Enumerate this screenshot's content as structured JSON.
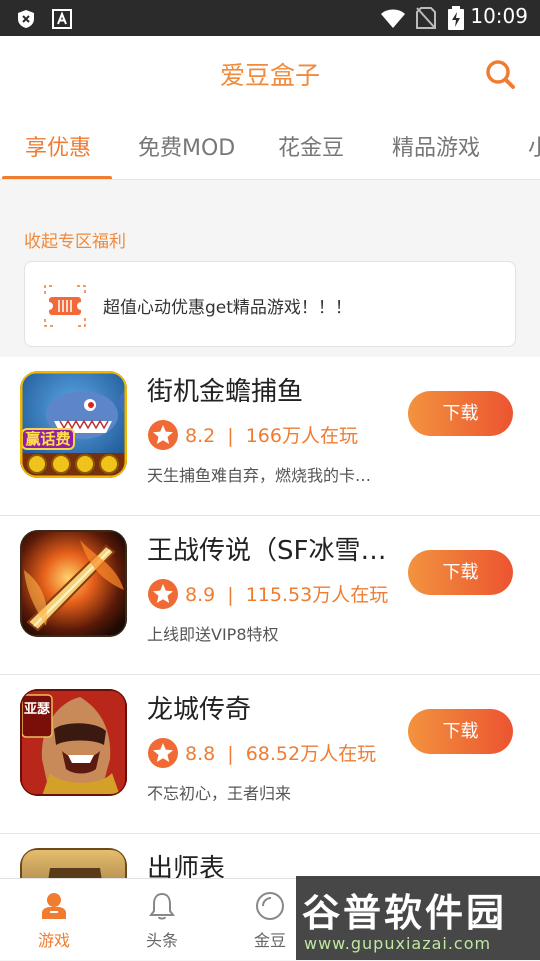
{
  "status_bar": {
    "time": "10:09",
    "icons": [
      "shield-x-icon",
      "a-box-icon",
      "wifi-icon",
      "no-sim-icon",
      "battery-charging-icon"
    ]
  },
  "header": {
    "title": "爱豆盒子",
    "search_icon": "search-icon"
  },
  "tabs": [
    {
      "label": "享优惠",
      "active": true
    },
    {
      "label": "免费MOD",
      "active": false
    },
    {
      "label": "花金豆",
      "active": false
    },
    {
      "label": "精品游戏",
      "active": false
    },
    {
      "label": "小",
      "active": false
    }
  ],
  "section": {
    "label": "收起专区福利"
  },
  "promo": {
    "icon": "ticket-icon",
    "text": "超值心动优惠get精品游戏！！！"
  },
  "games": [
    {
      "name": "街机金蟾捕鱼",
      "rating": "8.2",
      "separator": "|",
      "players": "166万人在玩",
      "desc": "天生捕鱼难自弃，燃烧我的卡…",
      "button": "下载",
      "icon_text": "赢话费"
    },
    {
      "name": "王战传说（SF冰雪…",
      "rating": "8.9",
      "separator": "|",
      "players": "115.53万人在玩",
      "desc": "上线即送VIP8特权",
      "button": "下载"
    },
    {
      "name": "龙城传奇",
      "rating": "8.8",
      "separator": "|",
      "players": "68.52万人在玩",
      "desc": "不忘初心，王者归来",
      "button": "下载",
      "icon_text": "亚瑟"
    },
    {
      "name": "出师表",
      "rating": "",
      "separator": "",
      "players": "",
      "desc": "",
      "button": ""
    }
  ],
  "bottom_nav": [
    {
      "label": "游戏",
      "icon": "gamepad-person-icon",
      "active": true
    },
    {
      "label": "头条",
      "icon": "bell-icon",
      "active": false
    },
    {
      "label": "金豆",
      "icon": "coin-icon",
      "active": false
    },
    {
      "label": "",
      "icon": "",
      "active": false
    },
    {
      "label": "",
      "icon": "",
      "active": false
    }
  ],
  "watermark": {
    "main": "谷普软件园",
    "url": "www.gupuxiazai.com"
  },
  "colors": {
    "accent": "#f07c32",
    "title": "#f08a3c",
    "button_from": "#f2933f",
    "button_to": "#ec5430",
    "status_bar": "#2b2b2b"
  }
}
